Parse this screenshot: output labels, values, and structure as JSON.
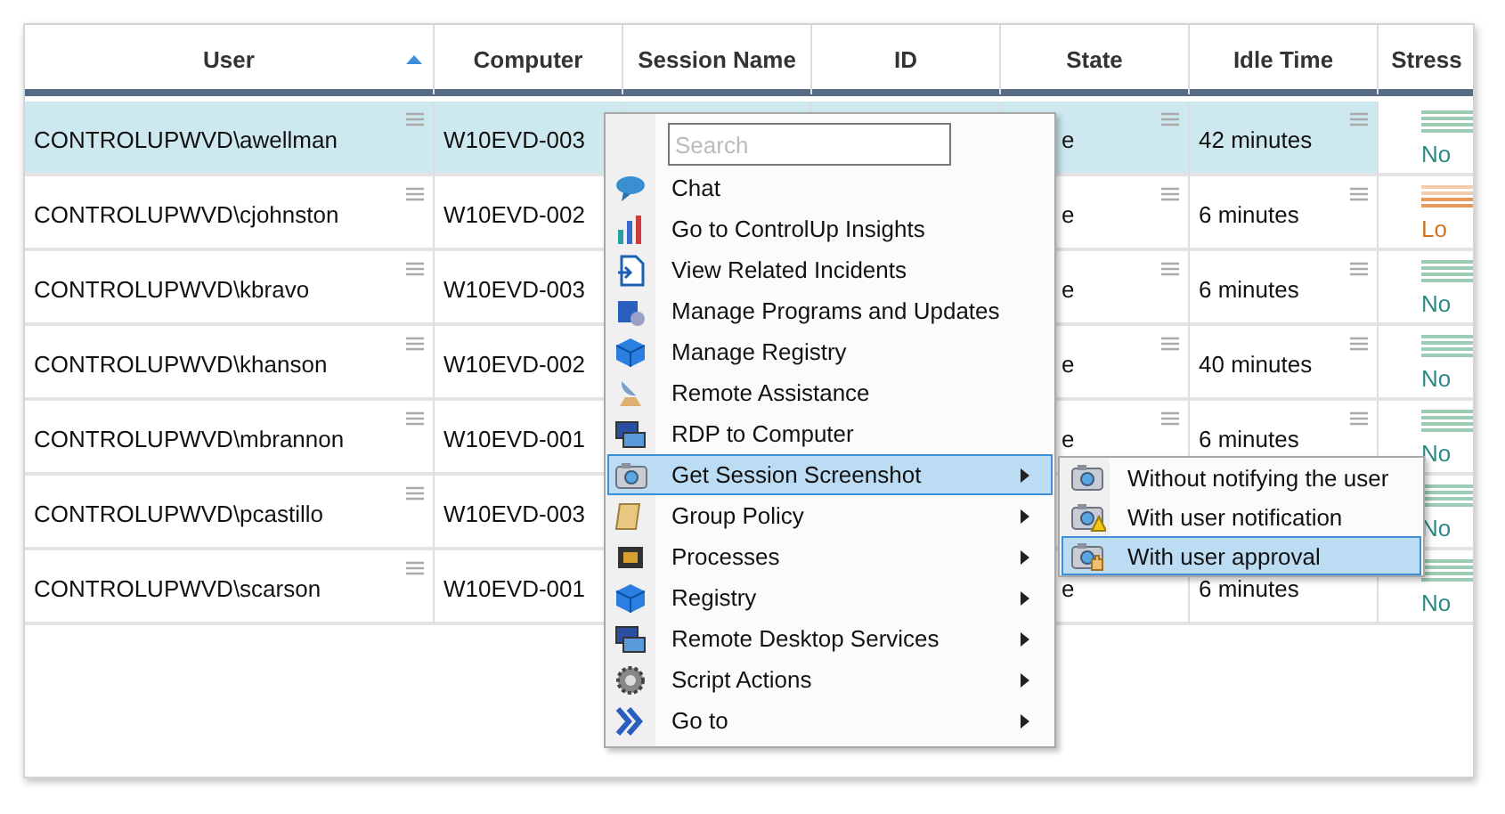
{
  "table": {
    "columns": [
      {
        "label": "User",
        "sorted": true
      },
      {
        "label": "Computer",
        "sorted": false
      },
      {
        "label": "Session Name",
        "sorted": false
      },
      {
        "label": "ID",
        "sorted": false
      },
      {
        "label": "State",
        "sorted": false
      },
      {
        "label": "Idle Time",
        "sorted": false
      },
      {
        "label": "Stress",
        "sorted": false
      }
    ],
    "rows": [
      {
        "selected": true,
        "user": "CONTROLUPWVD\\awellman",
        "computer": "W10EVD-003",
        "state": "e",
        "idle_time": "42 minutes",
        "stress": {
          "kind": "normal",
          "label": "No"
        }
      },
      {
        "selected": false,
        "user": "CONTROLUPWVD\\cjohnston",
        "computer": "W10EVD-002",
        "state": "e",
        "idle_time": "6 minutes",
        "stress": {
          "kind": "low",
          "label": "Lo"
        }
      },
      {
        "selected": false,
        "user": "CONTROLUPWVD\\kbravo",
        "computer": "W10EVD-003",
        "state": "e",
        "idle_time": "6 minutes",
        "stress": {
          "kind": "normal",
          "label": "No"
        }
      },
      {
        "selected": false,
        "user": "CONTROLUPWVD\\khanson",
        "computer": "W10EVD-002",
        "state": "e",
        "idle_time": "40 minutes",
        "stress": {
          "kind": "normal",
          "label": "No"
        }
      },
      {
        "selected": false,
        "user": "CONTROLUPWVD\\mbrannon",
        "computer": "W10EVD-001",
        "state": "e",
        "idle_time": "6 minutes",
        "stress": {
          "kind": "normal",
          "label": "No"
        }
      },
      {
        "selected": false,
        "user": "CONTROLUPWVD\\pcastillo",
        "computer": "W10EVD-003",
        "stress": {
          "kind": "normal",
          "label": "No"
        }
      },
      {
        "selected": false,
        "user": "CONTROLUPWVD\\scarson",
        "computer": "W10EVD-001",
        "state": "e",
        "idle_time": "6 minutes",
        "stress": {
          "kind": "normal",
          "label": "No"
        }
      }
    ]
  },
  "context_menu": {
    "search": {
      "placeholder": "Search"
    },
    "items": [
      {
        "label": "Chat",
        "has_submenu": false,
        "selected": false
      },
      {
        "label": "Go to ControlUp Insights",
        "has_submenu": false,
        "selected": false
      },
      {
        "label": "View Related Incidents",
        "has_submenu": false,
        "selected": false
      },
      {
        "label": "Manage Programs and Updates",
        "has_submenu": false,
        "selected": false
      },
      {
        "label": "Manage Registry",
        "has_submenu": false,
        "selected": false
      },
      {
        "label": "Remote Assistance",
        "has_submenu": false,
        "selected": false
      },
      {
        "label": "RDP to Computer",
        "has_submenu": false,
        "selected": false
      },
      {
        "label": "Get Session Screenshot",
        "has_submenu": true,
        "selected": true
      },
      {
        "label": "Group Policy",
        "has_submenu": true,
        "selected": false
      },
      {
        "label": "Processes",
        "has_submenu": true,
        "selected": false
      },
      {
        "label": "Registry",
        "has_submenu": true,
        "selected": false
      },
      {
        "label": "Remote Desktop Services",
        "has_submenu": true,
        "selected": false
      },
      {
        "label": "Script Actions",
        "has_submenu": true,
        "selected": false
      },
      {
        "label": "Go to",
        "has_submenu": true,
        "selected": false
      }
    ]
  },
  "submenu": {
    "items": [
      {
        "label": "Without notifying the user",
        "selected": false
      },
      {
        "label": "With user notification",
        "selected": false
      },
      {
        "label": "With user approval",
        "selected": true
      }
    ]
  }
}
